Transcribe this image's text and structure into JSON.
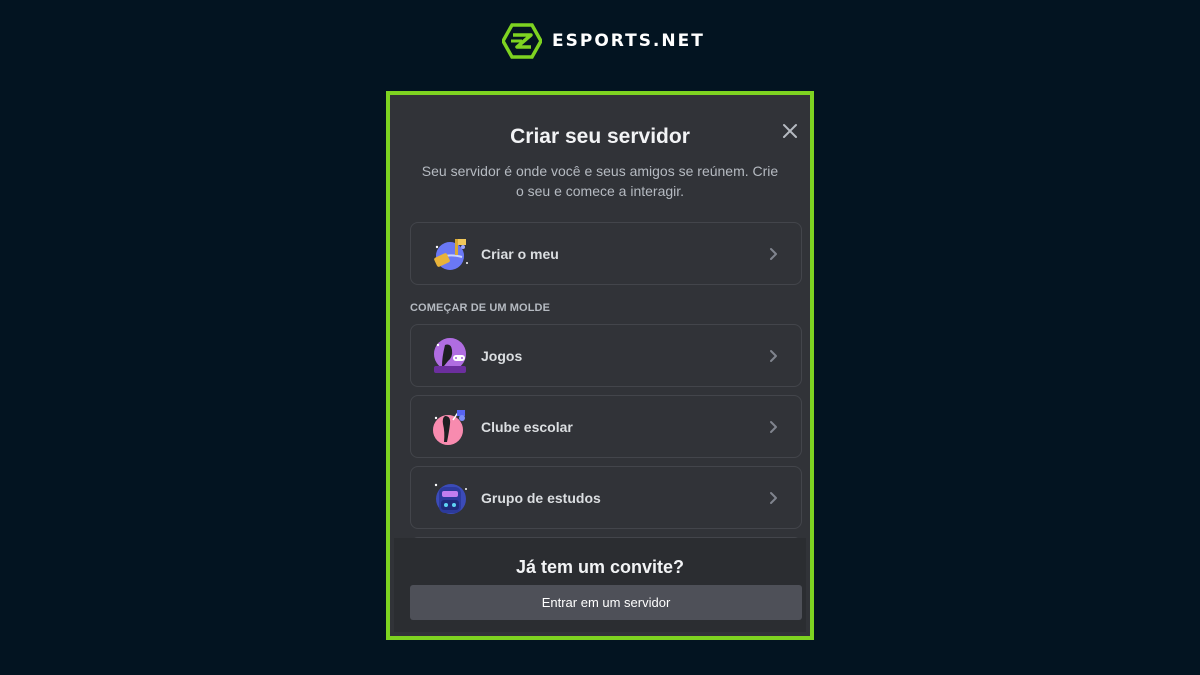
{
  "brand": {
    "name": "ESPORTS.NET",
    "logo_icon": "esports-logo-icon",
    "accent": "#7ed321"
  },
  "modal": {
    "title": "Criar seu servidor",
    "subtitle": "Seu servidor é onde você e seus amigos se reúnem. Crie o seu e comece a interagir.",
    "close_icon": "close-icon",
    "create_own": {
      "label": "Criar o meu",
      "icon": "globe-flag-icon"
    },
    "template_section": "COMEÇAR DE UM MOLDE",
    "templates": [
      {
        "label": "Jogos",
        "icon": "gaming-icon"
      },
      {
        "label": "Clube escolar",
        "icon": "school-club-icon"
      },
      {
        "label": "Grupo de estudos",
        "icon": "study-group-icon"
      }
    ],
    "invite": {
      "title": "Já tem um convite?",
      "button_label": "Entrar em um servidor"
    }
  }
}
